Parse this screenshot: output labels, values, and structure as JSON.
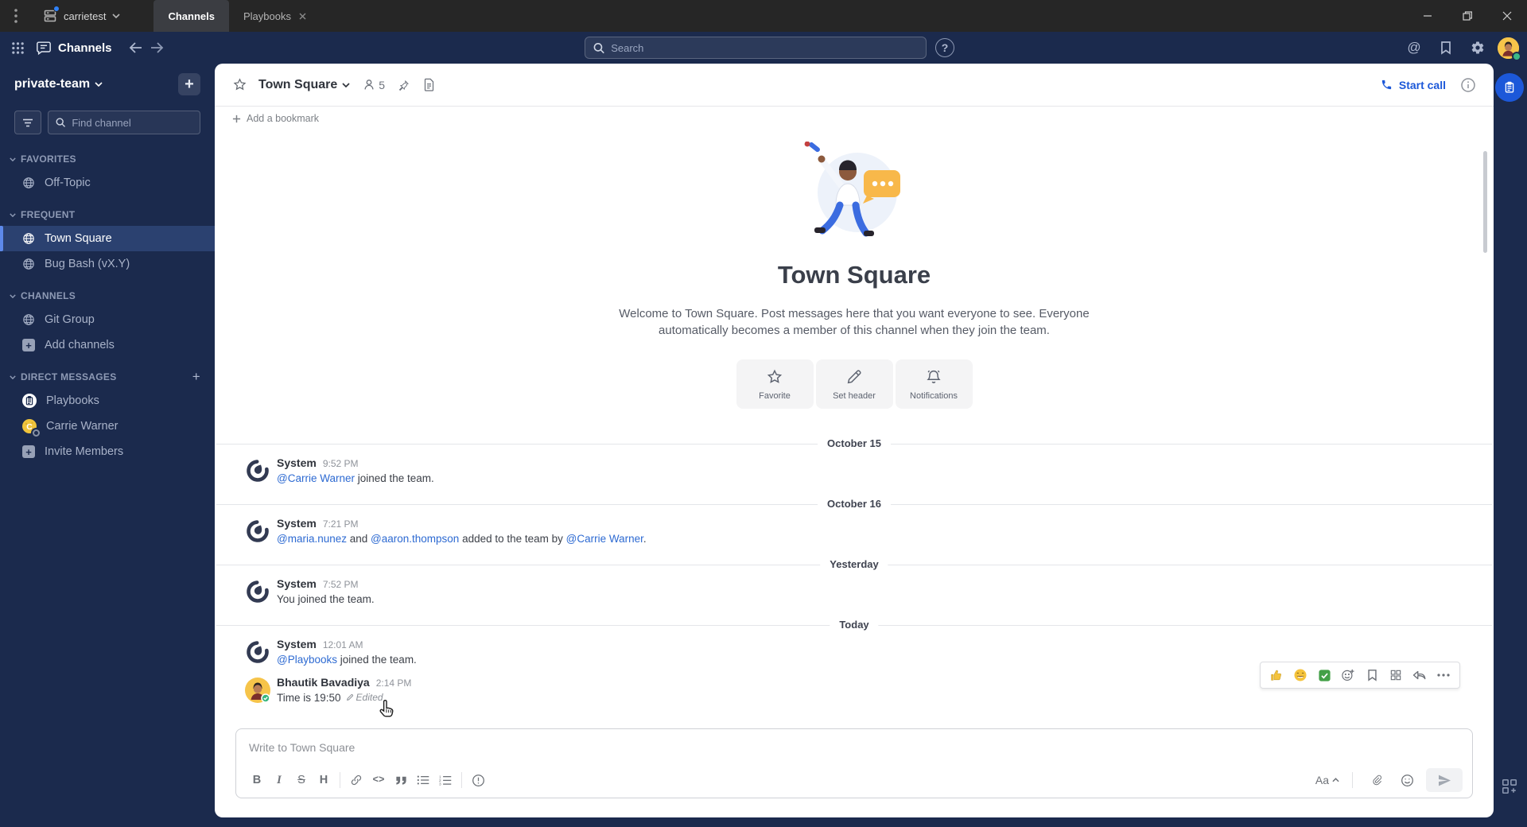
{
  "colors": {
    "accent": "#1c58d9",
    "navy": "#1b2a4d",
    "titlebar": "#262626",
    "link": "#2d6ad2",
    "selected_row": "#2b4170",
    "avatar_yellow": "#f6c44a",
    "online_green": "#3db887"
  },
  "titlebar": {
    "server": "carrietest",
    "tab_channels": "Channels",
    "tab_playbooks": "Playbooks"
  },
  "header": {
    "product": "Channels",
    "search_placeholder": "Search",
    "help_glyph": "?",
    "at_glyph": "@"
  },
  "sidebar": {
    "team": "private-team",
    "add_glyph": "+",
    "find_placeholder": "Find channel",
    "sections": [
      {
        "label": "FAVORITES"
      },
      {
        "label": "FREQUENT"
      },
      {
        "label": "CHANNELS"
      },
      {
        "label": "DIRECT MESSAGES"
      }
    ],
    "items": {
      "off_topic": "Off-Topic",
      "town_square": "Town Square",
      "bug_bash": "Bug Bash (vX.Y)",
      "git_group": "Git Group",
      "add_channels": "Add channels",
      "playbooks": "Playbooks",
      "carrie": "Carrie Warner",
      "carrie_initial": "c",
      "invite": "Invite Members"
    }
  },
  "channel": {
    "name": "Town Square",
    "members": "5",
    "start_call": "Start call",
    "add_bookmark": "Add a bookmark"
  },
  "intro": {
    "title": "Town Square",
    "welcome": "Welcome to Town Square. Post messages here that you want everyone to see. Everyone automatically becomes a member of this channel when they join the team.",
    "actions": {
      "favorite": "Favorite",
      "set_header": "Set header",
      "notifications": "Notifications"
    }
  },
  "dividers": {
    "d1": "October 15",
    "d2": "October 16",
    "d3": "Yesterday",
    "d4": "Today"
  },
  "posts": {
    "p1": {
      "author": "System",
      "time": "9:52 PM",
      "link1": "@Carrie Warner",
      "text1": " joined the team."
    },
    "p2": {
      "author": "System",
      "time": "7:21 PM",
      "link1": "@maria.nunez",
      "text1": " and ",
      "link2": "@aaron.thompson",
      "text2": " added to the team by ",
      "link3": "@Carrie Warner",
      "text3": "."
    },
    "p3": {
      "author": "System",
      "time": "7:52 PM",
      "text1": "You joined the team."
    },
    "p4": {
      "author": "System",
      "time": "12:01 AM",
      "link1": "@Playbooks",
      "text1": " joined the team."
    },
    "p5": {
      "author": "Bhautik Bavadiya",
      "time": "2:14 PM",
      "text1": "Time is 19:50",
      "edited": "Edited"
    }
  },
  "composer": {
    "placeholder": "Write to Town Square",
    "bold": "B",
    "italic": "I",
    "strike": "S",
    "heading": "H",
    "code": "<>",
    "format_toggle": "Aa"
  }
}
